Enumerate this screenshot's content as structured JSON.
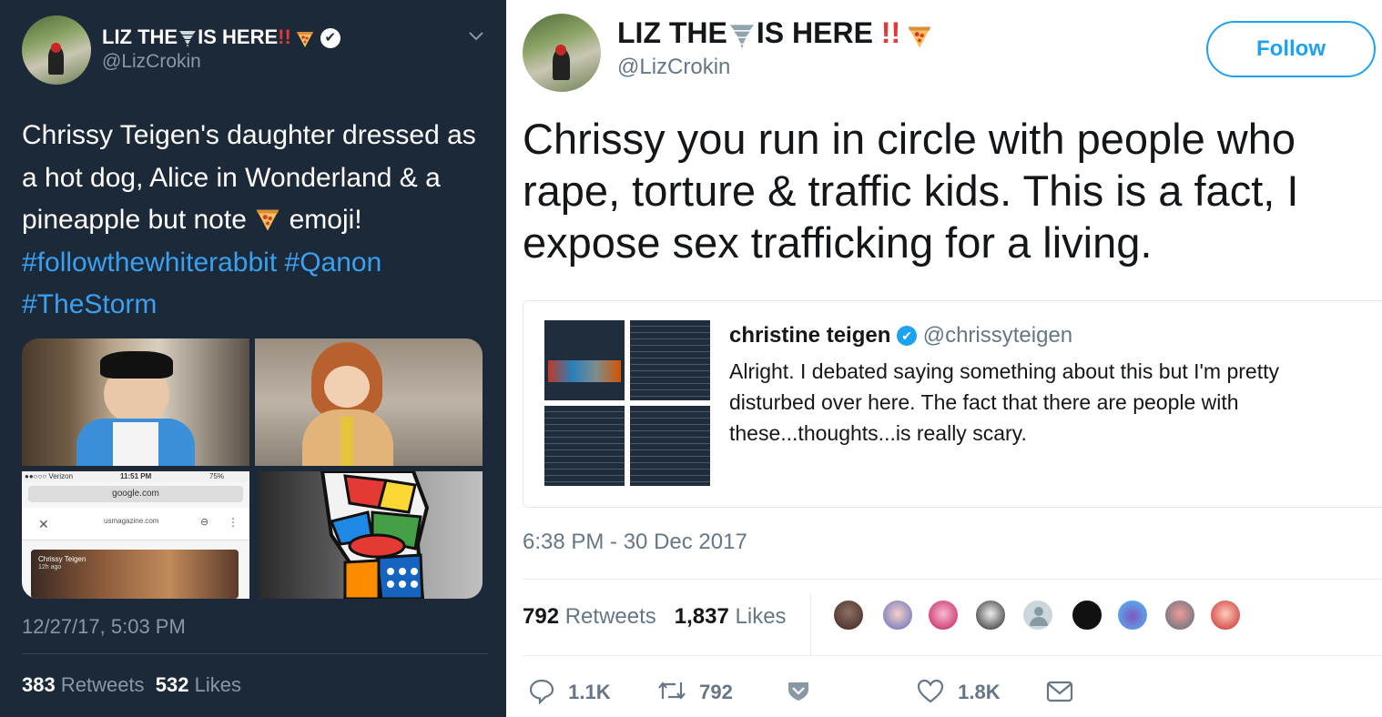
{
  "left": {
    "name_part1": "LIZ THE",
    "name_part2": "IS HERE",
    "handle": "@LizCrokin",
    "text_lines": [
      "Chrissy Teigen's daughter dressed as",
      "a hot dog, Alice in Wonderland & a",
      "pineapple but note"
    ],
    "text_tail": "emoji!",
    "hashtags": [
      "#followthewhiterabbit",
      "#Qanon",
      "#TheStorm"
    ],
    "timestamp": "12/27/17, 5:03 PM",
    "retweets_count": "383",
    "retweets_label": "Retweets",
    "likes_count": "532",
    "likes_label": "Likes",
    "phone": {
      "carrier": "●●○○○ Verizon",
      "time": "11:51 PM",
      "battery": "75%",
      "url": "google.com",
      "site": "usmagazine.com",
      "story_name": "Chrissy Teigen",
      "story_time": "12h ago"
    }
  },
  "right": {
    "name_part1": "LIZ THE",
    "name_part2": "IS HERE",
    "handle": "@LizCrokin",
    "follow_label": "Follow",
    "text_lines": [
      "Chrissy you run in circle with people who",
      "rape, torture & traffic kids. This is a fact, I",
      "expose sex trafficking for a living."
    ],
    "quote": {
      "name": "christine teigen",
      "handle": "@chrissyteigen",
      "lines": [
        "Alright. I debated saying something about this but I'm pretty",
        "disturbed over here. The fact that there are people with",
        "these...thoughts...is really scary."
      ]
    },
    "timestamp": "6:38 PM - 30 Dec 2017",
    "retweets_count": "792",
    "retweets_label": "Retweets",
    "likes_count": "1,837",
    "likes_label": "Likes",
    "actions": {
      "reply_count": "1.1K",
      "retweet_count": "792",
      "like_count": "1.8K"
    }
  },
  "colors": {
    "dark_bg": "#1c2938",
    "hashtag": "#3aa0ef",
    "twitter_blue": "#1da1f2",
    "text_gray": "#657786"
  }
}
